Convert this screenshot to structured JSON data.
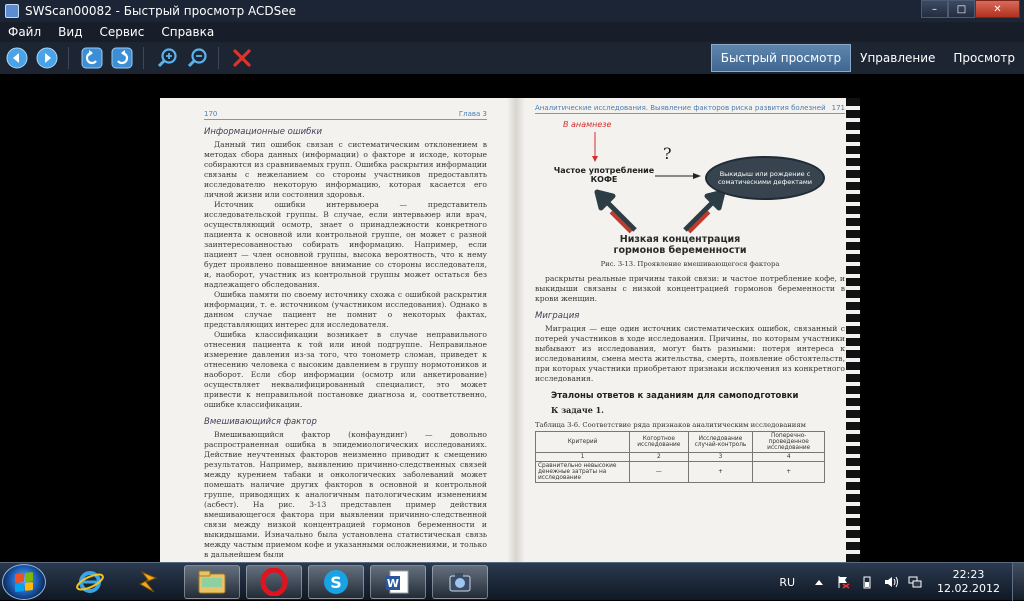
{
  "window": {
    "title": "SWScan00082 - Быстрый просмотр ACDSee",
    "controls": {
      "minimize": "–",
      "maximize": "□",
      "close": "✕"
    }
  },
  "menu": [
    "Файл",
    "Вид",
    "Сервис",
    "Справка"
  ],
  "toolbar": {
    "icons": [
      "back-arrow-icon",
      "forward-arrow-icon",
      "rotate-left-icon",
      "rotate-right-icon",
      "zoom-in-icon",
      "zoom-out-icon",
      "delete-icon"
    ]
  },
  "modes": {
    "quick_view": "Быстрый просмотр",
    "manage": "Управление",
    "view": "Просмотр"
  },
  "document": {
    "left": {
      "page_num": "170",
      "chapter": "Глава 3",
      "sec1_title": "Информационные ошибки",
      "p1": "Данный тип ошибок связан с систематическим отклонением в методах сбора данных (информации) о факторе и исходе, которые собираются из сравниваемых групп. Ошибка раскрытия информации связаны с нежеланием со стороны участников предоставлять исследователю некоторую информацию, которая касается его личной жизни или состояния здоровья.",
      "p2": "Источник ошибки интервьюера — представитель исследовательской группы. В случае, если интервьюер или врач, осуществляющий осмотр, знает о принадлежности конкретного пациента к основной или контрольной группе, он может с разной заинтересованностью собирать информацию. Например, если пациент — член основной группы, высока вероятность, что к нему будет проявлено повышенное внимание со стороны исследователя, и, наоборот, участник из контрольной группы может остаться без надлежащего обследования.",
      "p3": "Ошибка памяти по своему источнику схожа с ошибкой раскрытия информации, т. е. источником (участником исследования). Однако в данном случае пациент не помнит о некоторых фактах, представляющих интерес для исследователя.",
      "p4": "Ошибка классификации возникает в случае неправильного отнесения пациента к той или иной подгруппе. Неправильное измерение давления из-за того, что тонометр сломан, приведет к отнесению человека с высоким давлением в группу нормотоников и наоборот. Если сбор информации (осмотр или анкетирование) осуществляет неквалифицированный специалист, это может привести к неправильной постановке диагноза и, соответственно, ошибке классификации.",
      "sec2_title": "Вмешивающийся фактор",
      "p5": "Вмешивающийся фактор (конфаундинг) — довольно распространенная ошибка в эпидемиологических исследованиях. Действие неучтенных факторов неизменно приводит к смещению результатов. Например, выявлению причинно-следственных связей между курением табаки и онкологических заболеваний может помешать наличие других факторов в основной и контрольной группе, приводящих к аналогичным патологическим изменениям (асбест). На рис. 3-13 представлен пример действия вмешивающегося фактора при выявлении причинно-следственной связи между низкой концентрацией гормонов беременности и выкидышами. Изначально была установлена статистическая связь между частым приемом кофе и указанными осложнениями, и только в дальнейшем были"
    },
    "right": {
      "header": "Аналитические исследования. Выявление факторов риска развития болезней",
      "page_num": "171",
      "diagram": {
        "anamnesis": "В анамнезе",
        "coffee": "Частое употребление КОФЕ",
        "question": "?",
        "outcome": "Выкидыш или рождение с соматическими дефектами",
        "hormones": "Низкая концентрация гормонов беременности"
      },
      "fig_caption": "Рис. 3-13. Проявление вмешивающегося фактора",
      "p1": "раскрыты реальные причины такой связи: и частое потребление кофе, и выкидыши связаны с низкой концентрацией гормонов беременности в крови женщин.",
      "sec_title": "Миграция",
      "p2": "Миграция — еще один источник систематических ошибок, связанный с потерей участников в ходе исследования. Причины, по которым участники выбывают из исследования, могут быть разными: потеря интереса к исследованиям, смена места жительства, смерть, появление обстоятельств, при которых участники приобретают признаки исключения из конкретного исследования.",
      "answers_title": "Эталоны ответов к заданиям для самоподготовки",
      "task": "К задаче 1.",
      "table_caption": "Таблица 3-6. Соответствие ряда признаков аналитическим исследованиям",
      "table": {
        "headers": [
          "Критерий",
          "Когортное исследование",
          "Исследование случай-контроль",
          "Поперечно-проведенное исследование"
        ],
        "numbers": [
          "1",
          "2",
          "3",
          "4"
        ],
        "row1": [
          "Сравнительно невысокие денежные затраты на исследование",
          "—",
          "+",
          "+"
        ]
      }
    }
  },
  "taskbar": {
    "apps": [
      "ie-icon",
      "winamp-icon",
      "file-explorer-icon",
      "opera-icon",
      "skype-icon",
      "word-icon",
      "acdsee-icon"
    ],
    "lang": "RU",
    "time": "22:23",
    "date": "12.02.2012"
  },
  "colors": {
    "title_bg": "#1c2535",
    "toolbar_bg": "#1e2532",
    "active_tab": "#4f77a0",
    "diagram_red": "#d62d2d",
    "arrow_dark": "#2c3d46",
    "arrow_red": "#c0392b"
  }
}
